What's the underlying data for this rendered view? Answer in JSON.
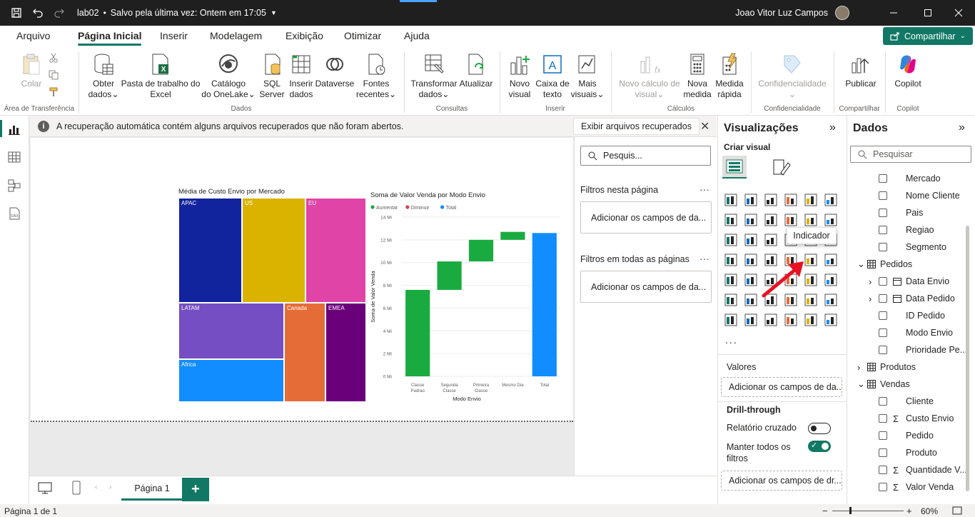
{
  "titlebar": {
    "filename": "lab02",
    "save_status": "Salvo pela última vez: Ontem em 17:05",
    "user_name": "Joao Vitor Luz Campos"
  },
  "menu_tabs": [
    "Arquivo",
    "Página Inicial",
    "Inserir",
    "Modelagem",
    "Exibição",
    "Otimizar",
    "Ajuda"
  ],
  "share_label": "Compartilhar",
  "ribbon": {
    "clipboard": {
      "colar": "Colar",
      "group": "Área de Transferência"
    },
    "dados": {
      "obter": "Obter",
      "obter2": "dados",
      "pasta": "Pasta de trabalho do",
      "pasta2": "Excel",
      "catalogo": "Catálogo",
      "catalogo2": "do OneLake",
      "sql": "SQL",
      "sql2": "Server",
      "inserir": "Inserir",
      "inserir2": "dados",
      "dataverse": "Dataverse",
      "fontes": "Fontes",
      "fontes2": "recentes",
      "group": "Dados"
    },
    "consultas": {
      "transformar": "Transformar",
      "transformar2": "dados",
      "atualizar": "Atualizar",
      "group": "Consultas"
    },
    "inserir_grp": {
      "novo": "Novo",
      "novo2": "visual",
      "caixa": "Caixa de",
      "caixa2": "texto",
      "mais": "Mais",
      "mais2": "visuais",
      "group": "Inserir"
    },
    "calculos": {
      "novo_calc": "Novo cálculo de",
      "novo_calc2": "visual",
      "nova_medida": "Nova",
      "nova_medida2": "medida",
      "medida_rapida": "Medida",
      "medida_rapida2": "rápida",
      "group": "Cálculos"
    },
    "confidencialidade": {
      "label": "Confidencialidade",
      "group": "Confidencialidade"
    },
    "compartilhar": {
      "publicar": "Publicar",
      "group": "Compartilhar"
    },
    "copilot": {
      "label": "Copilot",
      "group": "Copilot"
    }
  },
  "notification": {
    "message": "A recuperação automática contém alguns arquivos recuperados que não foram abertos.",
    "button": "Exibir arquivos recuperados"
  },
  "filters": {
    "search_placeholder": "Pesquis...",
    "this_page": "Filtros nesta página",
    "all_pages": "Filtros em todas as páginas",
    "add_fields": "Adicionar os campos de da..."
  },
  "visualizations": {
    "title": "Visualizações",
    "subtitle": "Criar visual",
    "tooltip": "Indicador",
    "more": "...",
    "valores": "Valores",
    "valores_drop": "Adicionar os campos de da...",
    "drill": "Drill-through",
    "relatorio": "Relatório cruzado",
    "manter": "Manter todos os",
    "manter2": "filtros",
    "drill_drop": "Adicionar os campos de dr..."
  },
  "data_pane": {
    "title": "Dados",
    "search_placeholder": "Pesquisar",
    "rows": [
      {
        "label": "Mercado",
        "level": 2
      },
      {
        "label": "Nome Cliente",
        "level": 2
      },
      {
        "label": "Pais",
        "level": 2
      },
      {
        "label": "Regiao",
        "level": 2
      },
      {
        "label": "Segmento",
        "level": 2
      },
      {
        "label": "Pedidos",
        "level": 0
      },
      {
        "label": "Data Envio",
        "level": 1
      },
      {
        "label": "Data Pedido",
        "level": 1
      },
      {
        "label": "ID Pedido",
        "level": 2
      },
      {
        "label": "Modo Envio",
        "level": 2
      },
      {
        "label": "Prioridade Pe...",
        "level": 2
      },
      {
        "label": "Produtos",
        "level": 0
      },
      {
        "label": "Vendas",
        "level": 0
      },
      {
        "label": "Cliente",
        "level": 2
      },
      {
        "label": "Custo Envio",
        "level": 2
      },
      {
        "label": "Pedido",
        "level": 2
      },
      {
        "label": "Produto",
        "level": 2
      },
      {
        "label": "Quantidade V...",
        "level": 2
      },
      {
        "label": "Valor Venda",
        "level": 2
      }
    ]
  },
  "page_tab": "Página 1",
  "status": {
    "page_info": "Página 1 de 1",
    "zoom": "60%"
  },
  "colors": {
    "accent": "#117865"
  },
  "chart_data": [
    {
      "type": "treemap",
      "title": "Média de Custo Envio por Mercado",
      "cells": [
        {
          "label": "APAC",
          "color": "#12239e"
        },
        {
          "label": "US",
          "color": "#d9b300"
        },
        {
          "label": "EU",
          "color": "#e044a7"
        },
        {
          "label": "LATAM",
          "color": "#744ec2"
        },
        {
          "label": "Canada",
          "color": "#e66c37"
        },
        {
          "label": "EMEA",
          "color": "#6b007b"
        },
        {
          "label": "Africa",
          "color": "#118dff"
        }
      ]
    },
    {
      "type": "waterfall",
      "title": "Soma de Valor Venda por Modo Envio",
      "legend": [
        "Aumentar",
        "Diminuir",
        "Total"
      ],
      "legend_colors": [
        "#1aab40",
        "#d64554",
        "#118dff"
      ],
      "xlabel": "Modo Envio",
      "ylabel": "Soma de Valor Venda",
      "yticks": [
        "0 Mi",
        "2 Mi",
        "4 Mi",
        "6 Mi",
        "8 Mi",
        "10 Mi",
        "12 Mi",
        "14 Mi"
      ],
      "ylim": [
        0,
        14
      ],
      "categories": [
        "Classe Padrao",
        "Segunda Classe",
        "Primeira Classe",
        "Mesmo Dia",
        "Total"
      ],
      "category_lines": [
        [
          "Classe",
          "Padrao"
        ],
        [
          "Segunda",
          "Classe"
        ],
        [
          "Primeira",
          "Classe"
        ],
        [
          "Mesmo Dia"
        ],
        [
          "Total"
        ]
      ],
      "values": [
        7.6,
        2.5,
        1.9,
        0.7,
        12.6
      ],
      "kinds": [
        "increase",
        "increase",
        "increase",
        "increase",
        "total"
      ]
    }
  ]
}
